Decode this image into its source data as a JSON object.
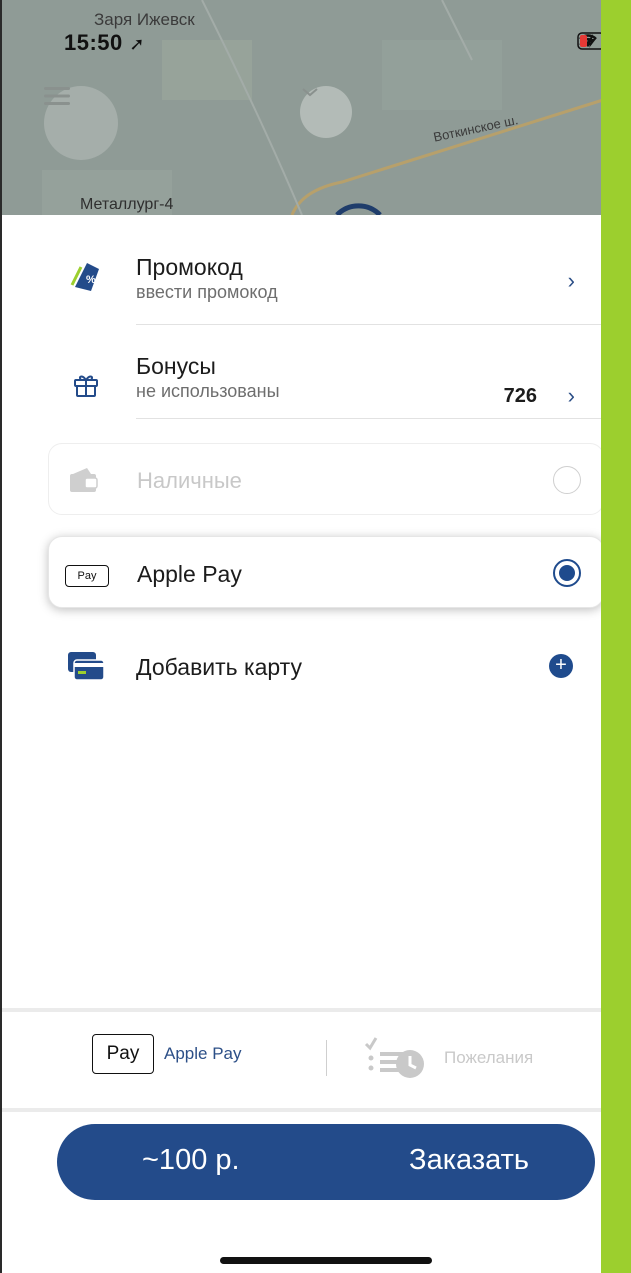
{
  "status_bar": {
    "time": "15:50",
    "location_icon": "location-arrow-icon",
    "dots": "....",
    "wifi_icon": "wifi-icon",
    "battery_icon": "battery-charging-icon"
  },
  "map": {
    "city": "Заря Ижевск",
    "district": "Металлург-4",
    "road": "Воткинское ш."
  },
  "promo": {
    "title": "Промокод",
    "subtitle": "ввести промокод"
  },
  "bonuses": {
    "title": "Бонусы",
    "subtitle": "не использованы",
    "value": "726"
  },
  "payment": {
    "cash": {
      "label": "Наличные",
      "selected": false
    },
    "apple_pay": {
      "label": "Apple Pay",
      "badge": "Pay",
      "selected": true
    },
    "add_card": {
      "label": "Добавить карту"
    }
  },
  "bottom_tabs": {
    "payment_badge": "Pay",
    "payment_label": "Apple Pay",
    "wishes_label": "Пожелания"
  },
  "order": {
    "price": "~100 р.",
    "button": "Заказать"
  },
  "colors": {
    "accent": "#234b8a",
    "map": "#8f9b96",
    "deco_green": "#9ccf2e"
  }
}
